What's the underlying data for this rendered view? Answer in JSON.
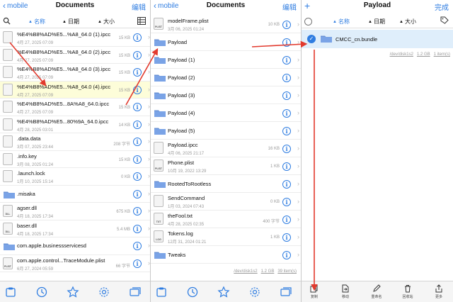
{
  "colors": {
    "accent": "#2f7de1",
    "arrow": "#e23a2e",
    "selected_row": "#fdfdd9"
  },
  "panel1": {
    "nav": {
      "back": "mobile",
      "title": "Documents",
      "right": "编辑"
    },
    "sort": {
      "name": "名称",
      "date": "日期",
      "size": "大小"
    },
    "rows": [
      {
        "kind": "file",
        "name": "%E4%B8%AD%E5...%A8_64.0 (1).ipcc",
        "date": "4月 27, 2025 07:09",
        "size": "15 KB"
      },
      {
        "kind": "file",
        "name": "%E4%B8%AD%E5...%A8_64.0 (2).ipcc",
        "date": "4月 27, 2025 07:09",
        "size": "15 KB"
      },
      {
        "kind": "file",
        "name": "%E4%B8%AD%E5...%A8_64.0 (3).ipcc",
        "date": "4月 27, 2025 07:09",
        "size": "15 KB"
      },
      {
        "kind": "file",
        "name": "%E4%B8%AD%E5...%A8_64.0 (4).ipcc",
        "date": "4月 27, 2025 07:09",
        "size": "15 KB",
        "selected": true
      },
      {
        "kind": "file",
        "name": "%E4%B8%AD%E5...8A%A8_64.0.ipcc",
        "date": "4月 27, 2025 07:09",
        "size": "15 KB"
      },
      {
        "kind": "file",
        "name": "%E4%B8%AD%E5...80%9A_64.0.ipcc",
        "date": "4月 28, 2025 03:01",
        "size": "14 KB"
      },
      {
        "kind": "file",
        "name": ".data.data",
        "date": "3月 07, 2025 23:44",
        "size": "208 字节"
      },
      {
        "kind": "file",
        "name": ".info.key",
        "date": "3月 08, 2025 01:24",
        "size": "15 KB"
      },
      {
        "kind": "file",
        "name": ".launch.lock",
        "date": "1月 10, 2025 15:14",
        "size": "0 KB"
      },
      {
        "kind": "folder",
        "name": ".misaka",
        "date": ""
      },
      {
        "kind": "file",
        "name": "agser.dll",
        "date": "4月 18, 2025 17:34",
        "size": "675 KB",
        "tag": "DLL"
      },
      {
        "kind": "file",
        "name": "baser.dll",
        "date": "4月 18, 2025 17:34",
        "size": "5.4 MB",
        "tag": "DLL"
      },
      {
        "kind": "folder",
        "name": "com.apple.businessservicesd",
        "date": ""
      },
      {
        "kind": "file",
        "name": "com.apple.control...TraceModule.plist",
        "date": "6月 27, 2024 05:59",
        "size": "66 字节",
        "tag": "PLIST"
      }
    ]
  },
  "panel2": {
    "nav": {
      "back": "mobile",
      "title": "Documents",
      "right": "编辑"
    },
    "rows": [
      {
        "kind": "file",
        "name": "modelFrame.plist",
        "date": "3月 06, 2025 01:24",
        "size": "10 KB",
        "tag": "PLIST"
      },
      {
        "kind": "folder",
        "name": "Payload",
        "date": ""
      },
      {
        "kind": "folder",
        "name": "Payload (1)",
        "date": ""
      },
      {
        "kind": "folder",
        "name": "Payload (2)",
        "date": ""
      },
      {
        "kind": "folder",
        "name": "Payload (3)",
        "date": ""
      },
      {
        "kind": "folder",
        "name": "Payload (4)",
        "date": ""
      },
      {
        "kind": "folder",
        "name": "Payload (5)",
        "date": ""
      },
      {
        "kind": "file",
        "name": "Payload.ipcc",
        "date": "4月 06, 2025 21:17",
        "size": "16 KB"
      },
      {
        "kind": "file",
        "name": "Phone.plist",
        "date": "10月 19, 2022 13:29",
        "size": "1 KB",
        "tag": "PLIST"
      },
      {
        "kind": "folder",
        "name": "RootedToRootless",
        "date": ""
      },
      {
        "kind": "file",
        "name": "SendCommand",
        "date": "1月 03, 2024 07:43",
        "size": "0 KB"
      },
      {
        "kind": "file",
        "name": "theFool.txt",
        "date": "4月 28, 2025 02:35",
        "size": "400 字节",
        "tag": "TXT"
      },
      {
        "kind": "file",
        "name": "Tokens.log",
        "date": "12月 31, 2024 01:21",
        "size": "1 KB",
        "tag": "LOG"
      },
      {
        "kind": "folder",
        "name": "Tweaks",
        "date": ""
      }
    ],
    "footer": {
      "disk": "/dev/disk1s2",
      "free": "1.2 GB",
      "count": "39 item(s)"
    }
  },
  "panel3": {
    "nav": {
      "title": "Payload",
      "right": "完成"
    },
    "sort": {
      "name": "名称",
      "date": "日期",
      "size": "大小"
    },
    "row": {
      "name": "CMCC_cn.bundle"
    },
    "footer": {
      "disk": "/dev/disk1s2",
      "free": "1.2 GB",
      "count": "1 item(s)"
    },
    "toolbar": [
      "复制",
      "移动",
      "重命名",
      "回收站",
      "更多"
    ]
  }
}
